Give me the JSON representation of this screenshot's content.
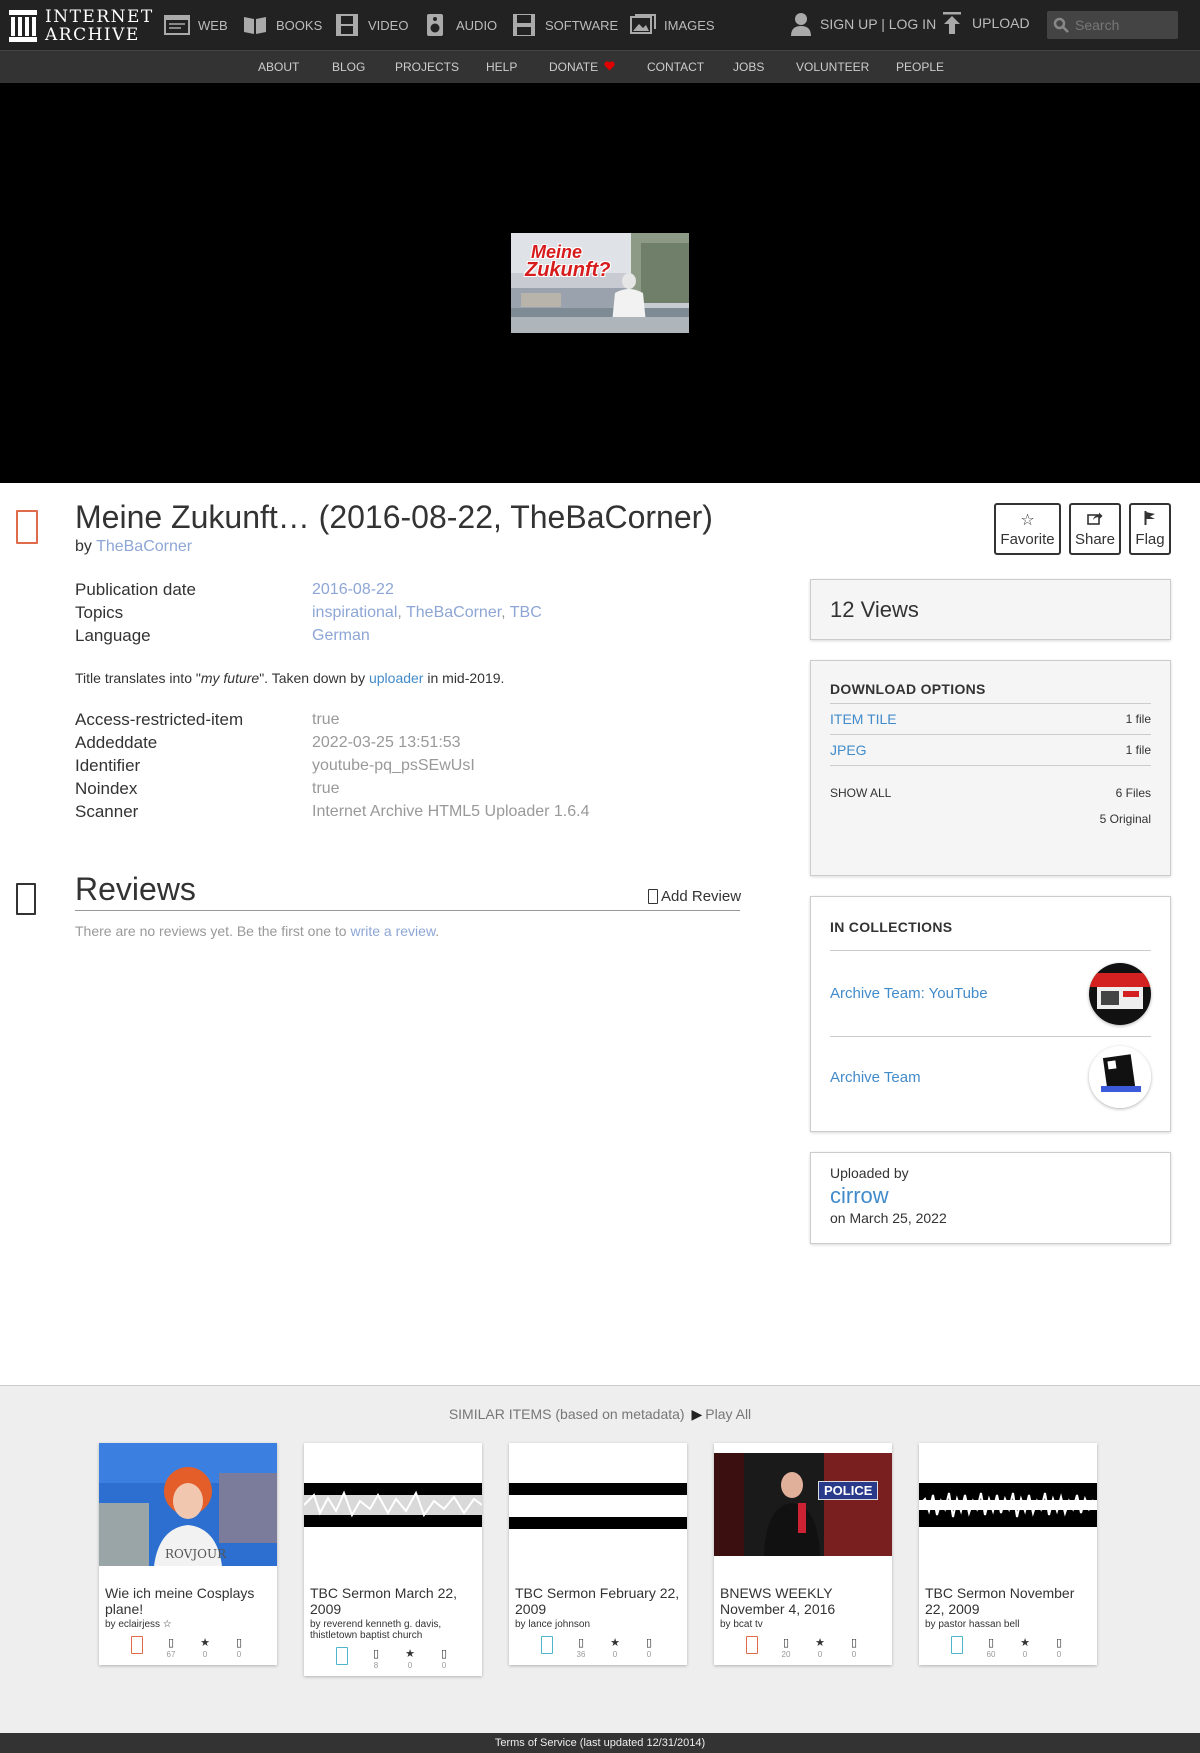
{
  "nav": {
    "logo_line1": "INTERNET",
    "logo_line2": "ARCHIVE",
    "media": [
      {
        "label": "WEB",
        "icon": "web-icon"
      },
      {
        "label": "BOOKS",
        "icon": "books-icon"
      },
      {
        "label": "VIDEO",
        "icon": "film-icon"
      },
      {
        "label": "AUDIO",
        "icon": "speaker-icon"
      },
      {
        "label": "SOFTWARE",
        "icon": "floppy-icon"
      },
      {
        "label": "IMAGES",
        "icon": "picture-icon"
      }
    ],
    "signup": "SIGN UP | LOG IN",
    "upload": "UPLOAD",
    "search_placeholder": "Search"
  },
  "subnav": [
    "ABOUT",
    "BLOG",
    "PROJECTS",
    "HELP",
    "DONATE",
    "CONTACT",
    "JOBS",
    "VOLUNTEER",
    "PEOPLE"
  ],
  "player": {
    "thumb_text_1": "Meine",
    "thumb_text_2": "Zukunft?"
  },
  "item": {
    "title": "Meine Zukunft… (2016-08-22, TheBaCorner)",
    "by_prefix": "by ",
    "creator": "TheBaCorner",
    "actions": {
      "favorite": "Favorite",
      "share": "Share",
      "flag": "Flag"
    },
    "publication_date_label": "Publication date",
    "publication_date": "2016-08-22",
    "topics_label": "Topics",
    "topics": [
      "inspirational",
      "TheBaCorner",
      "TBC"
    ],
    "topics_sep": ", ",
    "language_label": "Language",
    "language": "German",
    "desc_1": "Title translates into \"",
    "desc_em": "my future",
    "desc_2": "\". Taken down by ",
    "desc_link": "uploader",
    "desc_3": " in mid-2019.",
    "meta": [
      {
        "label": "Access-restricted-item",
        "value": "true"
      },
      {
        "label": "Addeddate",
        "value": "2022-03-25 13:51:53"
      },
      {
        "label": "Identifier",
        "value": "youtube-pq_psSEwUsI"
      },
      {
        "label": "Noindex",
        "value": "true"
      },
      {
        "label": "Scanner",
        "value": "Internet Archive HTML5 Uploader 1.6.4"
      }
    ]
  },
  "reviews": {
    "title": "Reviews",
    "add": "Add Review",
    "empty_1": "There are no reviews yet. Be the first one to ",
    "empty_link": "write a review",
    "empty_2": "."
  },
  "sidebar": {
    "views": "12 Views",
    "download_title": "DOWNLOAD OPTIONS",
    "downloads": [
      {
        "label": "ITEM TILE",
        "count": "1 file"
      },
      {
        "label": "JPEG",
        "count": "1 file"
      }
    ],
    "show_all": "SHOW ALL",
    "files": "6 Files",
    "original": "5 Original",
    "collections_title": "IN COLLECTIONS",
    "collections": [
      "Archive Team: YouTube",
      "Archive Team"
    ],
    "uploaded_by": "Uploaded by",
    "uploader": "cirrow",
    "uploaded_on": "on March 25, 2022"
  },
  "similar": {
    "heading": "SIMILAR ITEMS (based on metadata)",
    "play_all": "Play All",
    "items": [
      {
        "title": "Wie ich meine Cosplays plane!",
        "by": "by eclairjess ☆",
        "views": "67",
        "favs": "0",
        "reviews": "0"
      },
      {
        "title": "TBC Sermon March 22, 2009",
        "by": "by reverend kenneth g. davis, thistletown baptist church",
        "views": "8",
        "favs": "0",
        "reviews": "0"
      },
      {
        "title": "TBC Sermon February 22, 2009",
        "by": "by lance johnson",
        "views": "36",
        "favs": "0",
        "reviews": "0"
      },
      {
        "title": "BNEWS WEEKLY November 4, 2016",
        "by": "by bcat tv",
        "views": "20",
        "favs": "0",
        "reviews": "0"
      },
      {
        "title": "TBC Sermon November 22, 2009",
        "by": "by pastor hassan bell",
        "views": "60",
        "favs": "0",
        "reviews": "0"
      }
    ],
    "police_sign": "POLICE",
    "shirt_text": "ROVJOUR"
  },
  "footer": "Terms of Service (last updated 12/31/2014)",
  "colors": {
    "brand_link": "#428bca",
    "video_icon": "#e06b4b",
    "audio_icon": "#4fb5c8",
    "donate_heart": "#e00000"
  }
}
